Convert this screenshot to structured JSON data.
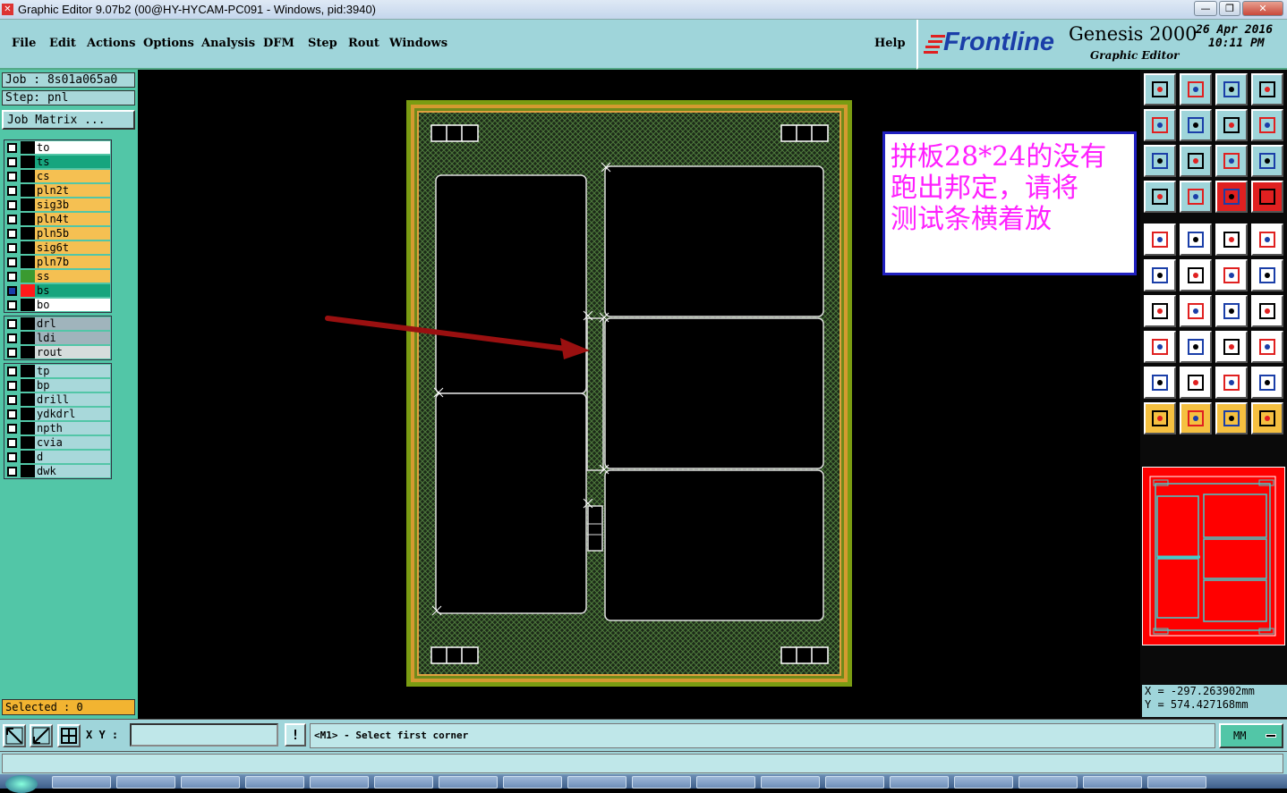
{
  "window": {
    "title": "Graphic Editor 9.07b2 (00@HY-HYCAM-PC091 - Windows, pid:3940)",
    "min": "—",
    "restore": "❐",
    "close": "✕"
  },
  "menu": {
    "items": [
      "File",
      "Edit",
      "Actions",
      "Options",
      "Analysis",
      "DFM",
      "Step",
      "Rout",
      "Windows"
    ],
    "help": "Help"
  },
  "logo": {
    "brand": "Frontline",
    "product": "Genesis 2000",
    "subtitle": "Graphic Editor",
    "date": "26 Apr 2016",
    "time": "10:11 PM"
  },
  "job": {
    "job_label": "Job  : 8s01a065a0",
    "step_label": "Step: pnl",
    "matrix_button": "Job Matrix ..."
  },
  "layers_group1": [
    {
      "name": "to",
      "color": "#ffffff"
    },
    {
      "name": "ts",
      "color": "#17a57e"
    },
    {
      "name": "cs",
      "color": "#f5c052"
    },
    {
      "name": "pln2t",
      "color": "#f5c052"
    },
    {
      "name": "sig3b",
      "color": "#f5c052"
    },
    {
      "name": "pln4t",
      "color": "#f5c052"
    },
    {
      "name": "pln5b",
      "color": "#f5c052"
    },
    {
      "name": "sig6t",
      "color": "#f5c052"
    },
    {
      "name": "pln7b",
      "color": "#f5c052"
    },
    {
      "name": "ss",
      "color": "#f5c052"
    },
    {
      "name": "bs",
      "color": "#17a57e"
    },
    {
      "name": "bo",
      "color": "#ffffff"
    }
  ],
  "layers_group2": [
    {
      "name": "drl",
      "color": "#a0b4bc"
    },
    {
      "name": "ldi",
      "color": "#a0b4bc"
    },
    {
      "name": "rout",
      "color": "#d6dcdc"
    }
  ],
  "layers_group3": [
    {
      "name": "tp",
      "color": "#a8d8da"
    },
    {
      "name": "bp",
      "color": "#a8d8da"
    },
    {
      "name": "drill",
      "color": "#a8d8da"
    },
    {
      "name": "ydkdrl",
      "color": "#a8d8da"
    },
    {
      "name": "npth",
      "color": "#a8d8da"
    },
    {
      "name": "cvia",
      "color": "#a8d8da"
    },
    {
      "name": "d",
      "color": "#a8d8da"
    },
    {
      "name": "dwk",
      "color": "#a8d8da"
    }
  ],
  "selected": "Selected : 0",
  "note": {
    "lines": [
      "拼板28*24的没有",
      "跑出邦定，请将",
      "测试条横着放"
    ]
  },
  "coords": {
    "x": "X = -297.263902mm",
    "y": "Y =  574.427168mm"
  },
  "bottom": {
    "xy_label": "X Y :",
    "xy_value": "",
    "prompt": "<M1> - Select first corner",
    "units": "MM",
    "alert": "!"
  },
  "toolbar_icons": [
    "zoom-home-icon",
    "zoom-fit-icon",
    "zoom-window-icon",
    "zoom-area-icon",
    "pan-left-icon",
    "pan-right-icon",
    "undo-icon",
    "redraw-icon",
    "zoom-extents-icon",
    "center-icon",
    "scale-1-2-icon",
    "help-icon",
    "settings-icon",
    "grid-icon",
    "layers-color-icon",
    "layers-icon",
    "pad-icon",
    "shape-icon",
    "ruler-icon",
    "circle-icon",
    "net-icon",
    "cross-icon",
    "connect-icon",
    "move-icon",
    "angle-icon",
    "line-icon",
    "arc-icon",
    "text-icon",
    "route-icon",
    "minus-icon",
    "fit-icon",
    "copy-icon",
    "triangle-icon",
    "text-a-icon",
    "text-a2-icon",
    "text-a3-icon",
    "select-icon",
    "select-box-icon",
    "select-circle-icon",
    "select-path-icon"
  ]
}
